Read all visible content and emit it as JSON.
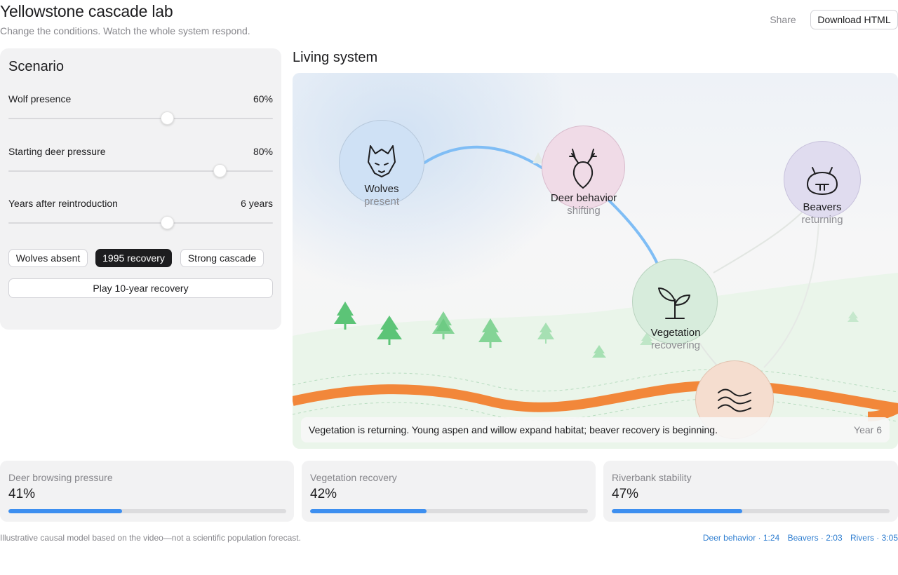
{
  "header": {
    "title": "Yellowstone cascade lab",
    "subtitle": "Change the conditions. Watch the whole system respond.",
    "share_label": "Share",
    "download_label": "Download HTML"
  },
  "scenario": {
    "title": "Scenario",
    "sliders": [
      {
        "label": "Wolf presence",
        "value_text": "60%",
        "level": 0.6
      },
      {
        "label": "Starting deer pressure",
        "value_text": "80%",
        "level": 0.8
      },
      {
        "label": "Years after reintroduction",
        "value_text": "6 years",
        "level": 0.6
      }
    ],
    "presets": [
      {
        "label": "Wolves absent",
        "active": false
      },
      {
        "label": "1995 recovery",
        "active": true
      },
      {
        "label": "Strong cascade",
        "active": false
      }
    ],
    "play_label": "Play 10-year recovery"
  },
  "system": {
    "title": "Living system",
    "nodes": {
      "wolves": {
        "label": "Wolves",
        "state": "present",
        "color": "#cfe1f5",
        "icon": "wolf-icon"
      },
      "deer": {
        "label": "Deer behavior",
        "state": "shifting",
        "color": "#f0dbe7",
        "icon": "deer-icon"
      },
      "beavers": {
        "label": "Beavers",
        "state": "returning",
        "color": "#e0dcef",
        "icon": "beaver-icon"
      },
      "vegetation": {
        "label": "Vegetation",
        "state": "recovering",
        "color": "#d7ecdc",
        "icon": "sprout-icon"
      },
      "river": {
        "label": "",
        "state": "",
        "color": "#f5ddcf",
        "icon": "water-waves-icon"
      }
    },
    "status_text": "Vegetation is returning. Young aspen and willow expand habitat; beaver recovery is beginning.",
    "year_text": "Year 6",
    "colors": {
      "link": "#7fbdf5",
      "river": "#f2873a",
      "tree": "#5cc477",
      "ground": "#eaf5ea"
    }
  },
  "metrics": [
    {
      "label": "Deer browsing pressure",
      "value_text": "41%",
      "fraction": 0.41
    },
    {
      "label": "Vegetation recovery",
      "value_text": "42%",
      "fraction": 0.42
    },
    {
      "label": "Riverbank stability",
      "value_text": "47%",
      "fraction": 0.47
    }
  ],
  "footer": {
    "note": "Illustrative causal model based on the video—not a scientific population forecast.",
    "links": [
      "Deer behavior · 1:24",
      "Beavers · 2:03",
      "Rivers · 3:05"
    ]
  }
}
